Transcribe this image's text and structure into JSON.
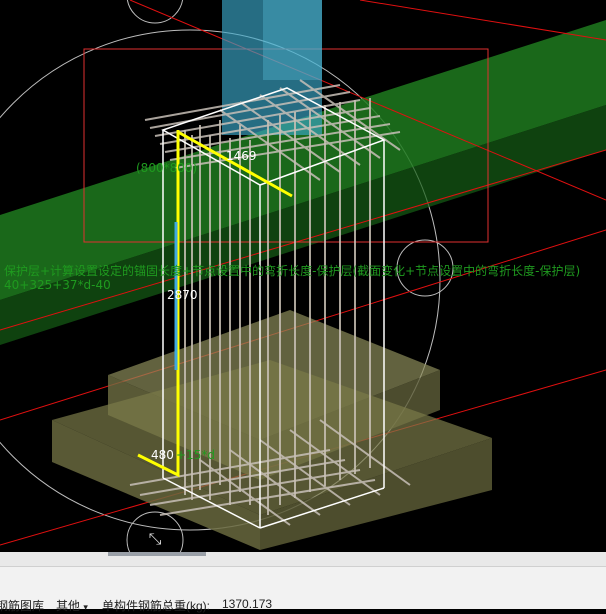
{
  "viewport": {
    "annotations": {
      "top_bar_label": "(800*800)",
      "top_bar_length": "1469",
      "column_bar_length": "2870",
      "bottom_bar_length": "480",
      "bottom_bar_formula": "+15*d",
      "formula_line1": "保护层+计算设置设定的锚固长度+节点设置中的弯折长度-保护层(截面变化+节点设置中的弯折长度-保护层)",
      "formula_line2": "40+325+37*d-40"
    }
  },
  "status_bar": {
    "rebar_category_label": "钢筋图库",
    "rebar_category_value": "其他",
    "unit_weight_label": "单构件钢筋总重(kg):",
    "unit_weight_value": "1370.173"
  },
  "colors": {
    "background": "#000000",
    "beam_green": "#1f7a1f",
    "footing_olive": "#6b6b3a",
    "column_blue": "#3ba7c9",
    "selection_yellow": "#ffff00",
    "red_guides": "#e01010"
  }
}
